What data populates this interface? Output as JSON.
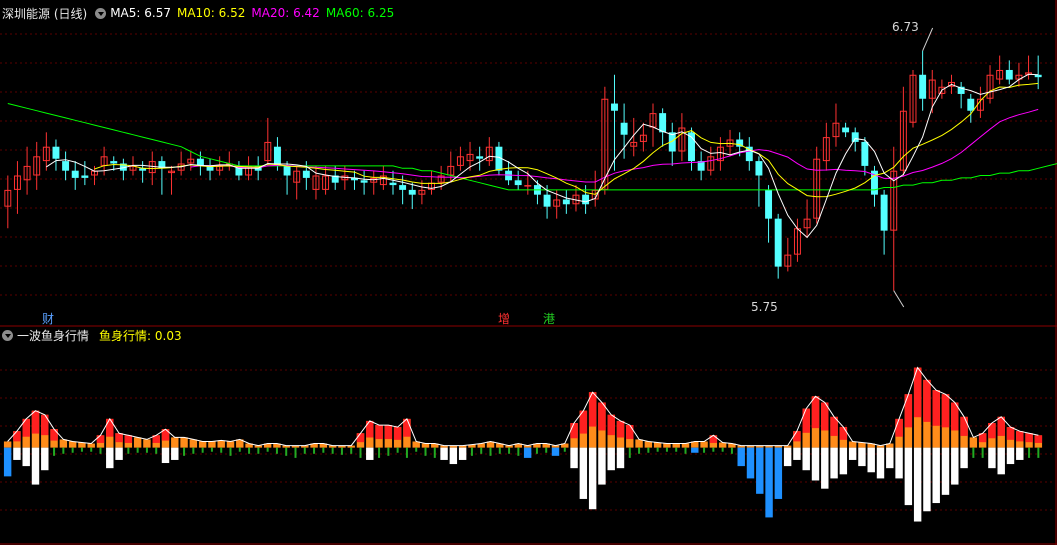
{
  "main": {
    "title": "深圳能源 (日线)",
    "ma": [
      {
        "label": "MA5: 6.57",
        "color": "#ffffff"
      },
      {
        "label": "MA10: 6.52",
        "color": "#ffff00"
      },
      {
        "label": "MA20: 6.42",
        "color": "#ff00ff"
      },
      {
        "label": "MA60: 6.25",
        "color": "#00ff00"
      }
    ],
    "high_label": "6.73",
    "low_label": "5.75",
    "price_range": [
      5.64,
      6.82
    ],
    "ma_period_colors": {
      "5": "#ffffff",
      "10": "#ffff00",
      "20": "#ff00ff",
      "60": "#00ff00"
    },
    "ma60_series": [
      6.48,
      6.47,
      6.46,
      6.45,
      6.44,
      6.43,
      6.42,
      6.41,
      6.4,
      6.39,
      6.38,
      6.37,
      6.36,
      6.35,
      6.34,
      6.33,
      6.32,
      6.31,
      6.3,
      6.28,
      6.26,
      6.25,
      6.24,
      6.23,
      6.22,
      6.22,
      6.22,
      6.22,
      6.22,
      6.22,
      6.22,
      6.22,
      6.22,
      6.22,
      6.22,
      6.22,
      6.22,
      6.22,
      6.22,
      6.22,
      6.22,
      6.21,
      6.21,
      6.2,
      6.2,
      6.19,
      6.18,
      6.17,
      6.16,
      6.15,
      6.14,
      6.13,
      6.12,
      6.12,
      6.12,
      6.12,
      6.12,
      6.12,
      6.12,
      6.12,
      6.12,
      6.12,
      6.12,
      6.12,
      6.12,
      6.12,
      6.12,
      6.12,
      6.12,
      6.12,
      6.12,
      6.12,
      6.12,
      6.12,
      6.12,
      6.12,
      6.12,
      6.12,
      6.12,
      6.12,
      6.12,
      6.12,
      6.12,
      6.12,
      6.12,
      6.12,
      6.12,
      6.12,
      6.12,
      6.12,
      6.12,
      6.13,
      6.13,
      6.14,
      6.14,
      6.15,
      6.15,
      6.16,
      6.16,
      6.17,
      6.17,
      6.18,
      6.18,
      6.19,
      6.19,
      6.2,
      6.2,
      6.21,
      6.22,
      6.23,
      6.24,
      6.25
    ],
    "candles": [
      [
        6.05,
        6.12,
        6.18,
        5.96
      ],
      [
        6.12,
        6.18,
        6.24,
        6.02
      ],
      [
        6.16,
        6.22,
        6.3,
        6.1
      ],
      [
        6.18,
        6.26,
        6.32,
        6.12
      ],
      [
        6.24,
        6.3,
        6.36,
        6.2
      ],
      [
        6.3,
        6.25,
        6.33,
        6.2
      ],
      [
        6.24,
        6.2,
        6.28,
        6.16
      ],
      [
        6.2,
        6.17,
        6.24,
        6.12
      ],
      [
        6.18,
        6.17,
        6.24,
        6.14
      ],
      [
        6.18,
        6.2,
        6.22,
        6.14
      ],
      [
        6.22,
        6.26,
        6.3,
        6.18
      ],
      [
        6.24,
        6.23,
        6.26,
        6.2
      ],
      [
        6.23,
        6.2,
        6.25,
        6.16
      ],
      [
        6.2,
        6.22,
        6.26,
        6.18
      ],
      [
        6.21,
        6.2,
        6.24,
        6.15
      ],
      [
        6.19,
        6.24,
        6.28,
        6.14
      ],
      [
        6.24,
        6.21,
        6.26,
        6.1
      ],
      [
        6.19,
        6.2,
        6.22,
        6.1
      ],
      [
        6.2,
        6.23,
        6.28,
        6.18
      ],
      [
        6.23,
        6.25,
        6.28,
        6.2
      ],
      [
        6.25,
        6.22,
        6.28,
        6.18
      ],
      [
        6.22,
        6.2,
        6.25,
        6.16
      ],
      [
        6.2,
        6.22,
        6.26,
        6.18
      ],
      [
        6.22,
        6.23,
        6.28,
        6.2
      ],
      [
        6.22,
        6.18,
        6.24,
        6.16
      ],
      [
        6.18,
        6.22,
        6.26,
        6.16
      ],
      [
        6.22,
        6.2,
        6.26,
        6.16
      ],
      [
        6.24,
        6.32,
        6.42,
        6.22
      ],
      [
        6.3,
        6.22,
        6.34,
        6.2
      ],
      [
        6.22,
        6.18,
        6.24,
        6.1
      ],
      [
        6.15,
        6.2,
        6.22,
        6.08
      ],
      [
        6.2,
        6.17,
        6.24,
        6.12
      ],
      [
        6.12,
        6.18,
        6.22,
        6.08
      ],
      [
        6.12,
        6.18,
        6.22,
        6.1
      ],
      [
        6.18,
        6.15,
        6.22,
        6.12
      ],
      [
        6.16,
        6.18,
        6.22,
        6.12
      ],
      [
        6.17,
        6.16,
        6.2,
        6.12
      ],
      [
        6.16,
        6.15,
        6.2,
        6.1
      ],
      [
        6.15,
        6.17,
        6.2,
        6.1
      ],
      [
        6.14,
        6.18,
        6.22,
        6.12
      ],
      [
        6.15,
        6.14,
        6.2,
        6.1
      ],
      [
        6.14,
        6.12,
        6.18,
        6.06
      ],
      [
        6.12,
        6.1,
        6.15,
        6.04
      ],
      [
        6.1,
        6.12,
        6.16,
        6.06
      ],
      [
        6.12,
        6.15,
        6.2,
        6.1
      ],
      [
        6.15,
        6.18,
        6.22,
        6.12
      ],
      [
        6.18,
        6.22,
        6.28,
        6.15
      ],
      [
        6.22,
        6.26,
        6.3,
        6.2
      ],
      [
        6.24,
        6.27,
        6.32,
        6.2
      ],
      [
        6.26,
        6.25,
        6.3,
        6.2
      ],
      [
        6.24,
        6.3,
        6.34,
        6.22
      ],
      [
        6.3,
        6.2,
        6.32,
        6.18
      ],
      [
        6.2,
        6.16,
        6.24,
        6.14
      ],
      [
        6.16,
        6.14,
        6.2,
        6.12
      ],
      [
        6.14,
        6.14,
        6.2,
        6.1
      ],
      [
        6.14,
        6.1,
        6.16,
        6.06
      ],
      [
        6.1,
        6.05,
        6.14,
        6.0
      ],
      [
        6.05,
        6.08,
        6.12,
        6.0
      ],
      [
        6.08,
        6.06,
        6.12,
        6.02
      ],
      [
        6.06,
        6.1,
        6.14,
        6.03
      ],
      [
        6.1,
        6.06,
        6.14,
        6.02
      ],
      [
        6.08,
        6.12,
        6.2,
        6.05
      ],
      [
        6.12,
        6.5,
        6.55,
        6.1
      ],
      [
        6.48,
        6.45,
        6.6,
        6.2
      ],
      [
        6.4,
        6.35,
        6.48,
        6.25
      ],
      [
        6.3,
        6.32,
        6.42,
        6.26
      ],
      [
        6.32,
        6.35,
        6.4,
        6.28
      ],
      [
        6.38,
        6.44,
        6.48,
        6.3
      ],
      [
        6.44,
        6.36,
        6.46,
        6.3
      ],
      [
        6.36,
        6.28,
        6.4,
        6.22
      ],
      [
        6.28,
        6.38,
        6.44,
        6.24
      ],
      [
        6.36,
        6.24,
        6.38,
        6.2
      ],
      [
        6.24,
        6.2,
        6.28,
        6.16
      ],
      [
        6.2,
        6.26,
        6.3,
        6.18
      ],
      [
        6.24,
        6.3,
        6.34,
        6.2
      ],
      [
        6.3,
        6.33,
        6.37,
        6.26
      ],
      [
        6.33,
        6.3,
        6.36,
        6.26
      ],
      [
        6.3,
        6.24,
        6.34,
        6.2
      ],
      [
        6.24,
        6.18,
        6.26,
        6.05
      ],
      [
        6.12,
        6.0,
        6.14,
        5.9
      ],
      [
        6.0,
        5.8,
        6.02,
        5.75
      ],
      [
        5.8,
        5.85,
        5.92,
        5.78
      ],
      [
        5.85,
        5.96,
        6.0,
        5.82
      ],
      [
        5.96,
        6.0,
        6.08,
        5.92
      ],
      [
        6.0,
        6.25,
        6.3,
        5.98
      ],
      [
        6.24,
        6.34,
        6.4,
        6.2
      ],
      [
        6.34,
        6.4,
        6.48,
        6.3
      ],
      [
        6.38,
        6.36,
        6.4,
        6.34
      ],
      [
        6.36,
        6.32,
        6.38,
        6.28
      ],
      [
        6.32,
        6.22,
        6.34,
        6.18
      ],
      [
        6.2,
        6.1,
        6.22,
        6.05
      ],
      [
        6.1,
        5.95,
        6.12,
        5.85
      ],
      [
        5.95,
        6.2,
        6.3,
        5.7
      ],
      [
        6.2,
        6.45,
        6.55,
        6.18
      ],
      [
        6.4,
        6.6,
        6.62,
        6.38
      ],
      [
        6.6,
        6.5,
        6.7,
        6.45
      ],
      [
        6.5,
        6.58,
        6.62,
        6.44
      ],
      [
        6.52,
        6.55,
        6.58,
        6.5
      ],
      [
        6.55,
        6.57,
        6.6,
        6.52
      ],
      [
        6.55,
        6.52,
        6.57,
        6.46
      ],
      [
        6.5,
        6.45,
        6.52,
        6.4
      ],
      [
        6.45,
        6.5,
        6.55,
        6.42
      ],
      [
        6.5,
        6.6,
        6.64,
        6.48
      ],
      [
        6.58,
        6.62,
        6.68,
        6.56
      ],
      [
        6.62,
        6.58,
        6.66,
        6.56
      ],
      [
        6.58,
        6.6,
        6.65,
        6.55
      ],
      [
        6.6,
        6.61,
        6.68,
        6.58
      ],
      [
        6.6,
        6.59,
        6.68,
        6.54
      ]
    ]
  },
  "marks": [
    {
      "label": "财",
      "color": "#5aa0ff"
    },
    {
      "label": "增",
      "color": "#ff3030"
    },
    {
      "label": "港",
      "color": "#22cc22"
    }
  ],
  "sub": {
    "title": "一波鱼身行情",
    "value_label": "鱼身行情: 0.03",
    "value_color": "#ffff00",
    "range": [
      -0.9,
      1.0
    ],
    "colors": {
      "pos_strong": "#ff2020",
      "pos_weak": "#ff8c1a",
      "neg_small": "#22aa22",
      "neg_big": "#ffffff",
      "neg_blue": "#1e90ff"
    },
    "bars": [
      [
        0.06,
        -0.28,
        1
      ],
      [
        0.16,
        -0.12,
        0
      ],
      [
        0.28,
        -0.18,
        0
      ],
      [
        0.36,
        -0.36,
        0
      ],
      [
        0.32,
        -0.22,
        0
      ],
      [
        0.18,
        -0.08,
        0
      ],
      [
        0.08,
        -0.06,
        0
      ],
      [
        0.06,
        -0.05,
        0
      ],
      [
        0.05,
        -0.04,
        0
      ],
      [
        0.04,
        -0.04,
        0
      ],
      [
        0.12,
        -0.06,
        0
      ],
      [
        0.28,
        -0.2,
        0
      ],
      [
        0.14,
        -0.12,
        0
      ],
      [
        0.12,
        -0.06,
        0
      ],
      [
        0.1,
        -0.05,
        0
      ],
      [
        0.08,
        -0.05,
        0
      ],
      [
        0.12,
        -0.06,
        0
      ],
      [
        0.18,
        -0.15,
        0
      ],
      [
        0.1,
        -0.12,
        0
      ],
      [
        0.1,
        -0.08,
        0
      ],
      [
        0.08,
        -0.06,
        0
      ],
      [
        0.06,
        -0.05,
        0
      ],
      [
        0.06,
        -0.04,
        0
      ],
      [
        0.07,
        -0.05,
        0
      ],
      [
        0.06,
        -0.08,
        0
      ],
      [
        0.08,
        -0.04,
        0
      ],
      [
        0.04,
        -0.06,
        0
      ],
      [
        0.02,
        -0.06,
        0
      ],
      [
        0.04,
        -0.04,
        0
      ],
      [
        0.04,
        -0.06,
        0
      ],
      [
        0.02,
        -0.08,
        0
      ],
      [
        0.02,
        -0.1,
        0
      ],
      [
        0.02,
        -0.06,
        0
      ],
      [
        0.04,
        -0.06,
        0
      ],
      [
        0.04,
        -0.05,
        0
      ],
      [
        0.02,
        -0.06,
        0
      ],
      [
        0.02,
        -0.07,
        0
      ],
      [
        0.02,
        -0.06,
        0
      ],
      [
        0.14,
        -0.1,
        0
      ],
      [
        0.26,
        -0.12,
        0
      ],
      [
        0.22,
        -0.1,
        0
      ],
      [
        0.22,
        -0.08,
        0
      ],
      [
        0.2,
        -0.05,
        0
      ],
      [
        0.28,
        -0.1,
        0
      ],
      [
        0.06,
        -0.04,
        0
      ],
      [
        0.04,
        -0.08,
        0
      ],
      [
        0.04,
        -0.1,
        0
      ],
      [
        0.02,
        -0.12,
        0
      ],
      [
        0.02,
        -0.16,
        0
      ],
      [
        0.02,
        -0.12,
        0
      ],
      [
        0.03,
        -0.08,
        0
      ],
      [
        0.04,
        -0.06,
        0
      ],
      [
        0.06,
        -0.08,
        0
      ],
      [
        0.04,
        -0.06,
        0
      ],
      [
        0.02,
        -0.06,
        0
      ],
      [
        0.04,
        -0.08,
        0
      ],
      [
        0.02,
        -0.1,
        1
      ],
      [
        0.04,
        -0.06,
        0
      ],
      [
        0.04,
        -0.05,
        0
      ],
      [
        0.02,
        -0.08,
        1
      ],
      [
        0.04,
        -0.04,
        0
      ],
      [
        0.24,
        -0.2,
        0
      ],
      [
        0.36,
        -0.5,
        0
      ],
      [
        0.54,
        -0.6,
        0
      ],
      [
        0.44,
        -0.36,
        0
      ],
      [
        0.32,
        -0.22,
        0
      ],
      [
        0.26,
        -0.2,
        0
      ],
      [
        0.22,
        -0.1,
        0
      ],
      [
        0.08,
        -0.06,
        0
      ],
      [
        0.06,
        -0.05,
        0
      ],
      [
        0.05,
        -0.04,
        0
      ],
      [
        0.04,
        -0.04,
        0
      ],
      [
        0.04,
        -0.04,
        0
      ],
      [
        0.04,
        -0.06,
        0
      ],
      [
        0.06,
        -0.05,
        1
      ],
      [
        0.06,
        -0.05,
        0
      ],
      [
        0.12,
        -0.04,
        0
      ],
      [
        0.05,
        -0.04,
        0
      ],
      [
        0.04,
        -0.06,
        0
      ],
      [
        0.02,
        -0.18,
        1
      ],
      [
        0.02,
        -0.3,
        1
      ],
      [
        0.02,
        -0.45,
        1
      ],
      [
        0.02,
        -0.68,
        1
      ],
      [
        0.02,
        -0.5,
        1
      ],
      [
        0.02,
        -0.18,
        0
      ],
      [
        0.16,
        -0.12,
        0
      ],
      [
        0.38,
        -0.22,
        0
      ],
      [
        0.5,
        -0.32,
        0
      ],
      [
        0.44,
        -0.4,
        0
      ],
      [
        0.3,
        -0.3,
        0
      ],
      [
        0.2,
        -0.26,
        0
      ],
      [
        0.06,
        -0.12,
        0
      ],
      [
        0.05,
        -0.18,
        0
      ],
      [
        0.04,
        -0.24,
        0
      ],
      [
        0.02,
        -0.3,
        0
      ],
      [
        0.04,
        -0.2,
        0
      ],
      [
        0.28,
        -0.3,
        0
      ],
      [
        0.52,
        -0.56,
        0
      ],
      [
        0.78,
        -0.72,
        0
      ],
      [
        0.66,
        -0.62,
        0
      ],
      [
        0.56,
        -0.54,
        0
      ],
      [
        0.52,
        -0.46,
        0
      ],
      [
        0.44,
        -0.36,
        0
      ],
      [
        0.3,
        -0.2,
        0
      ],
      [
        0.1,
        -0.1,
        0
      ],
      [
        0.14,
        -0.1,
        0
      ],
      [
        0.24,
        -0.2,
        0
      ],
      [
        0.3,
        -0.26,
        0
      ],
      [
        0.2,
        -0.16,
        0
      ],
      [
        0.16,
        -0.12,
        0
      ],
      [
        0.14,
        -0.1,
        0
      ],
      [
        0.12,
        -0.1,
        0
      ]
    ]
  }
}
